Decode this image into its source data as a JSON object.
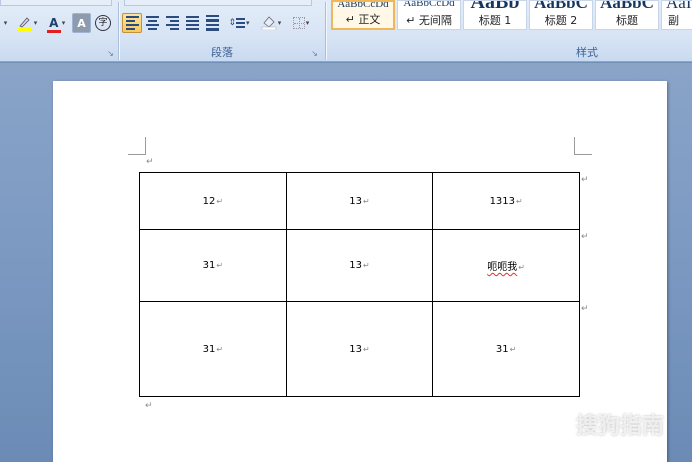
{
  "ribbon": {
    "font_group": {
      "highlight_icon": "highlighter-pen-icon",
      "font_color_icon": "font-color-A-icon",
      "font_color_label": "A",
      "char_shading_label": "A",
      "enclose_char_label": "字",
      "colors": {
        "highlight": "#ffff00",
        "font_color": "#e02020"
      }
    },
    "paragraph_group": {
      "label": "段落",
      "alignments": [
        "align-left",
        "align-center",
        "align-right",
        "justify",
        "distributed"
      ],
      "active_alignment": "align-left"
    },
    "styles_group": {
      "label": "样式",
      "styles": [
        {
          "preview": "AaBbCcDd",
          "name": "↵ 正文",
          "selected": true
        },
        {
          "preview": "AaBbCcDd",
          "name": "↵ 无间隔",
          "selected": false
        },
        {
          "preview": "AaBb",
          "name": "标题 1",
          "selected": false
        },
        {
          "preview": "AaBbC",
          "name": "标题 2",
          "selected": false
        },
        {
          "preview": "AaBbC",
          "name": "标题",
          "selected": false
        },
        {
          "preview": "AaI",
          "name": "副",
          "selected": false
        }
      ]
    }
  },
  "document": {
    "table": {
      "rows": [
        [
          "12",
          "13",
          "1313"
        ],
        [
          "31",
          "13",
          "呃呃我"
        ],
        [
          "31",
          "13",
          "31"
        ]
      ]
    },
    "cell_end_mark": "↵",
    "paragraph_mark": "↵"
  },
  "watermark": {
    "text": "搜狗指南",
    "url": "zhinan.sogou.com"
  }
}
